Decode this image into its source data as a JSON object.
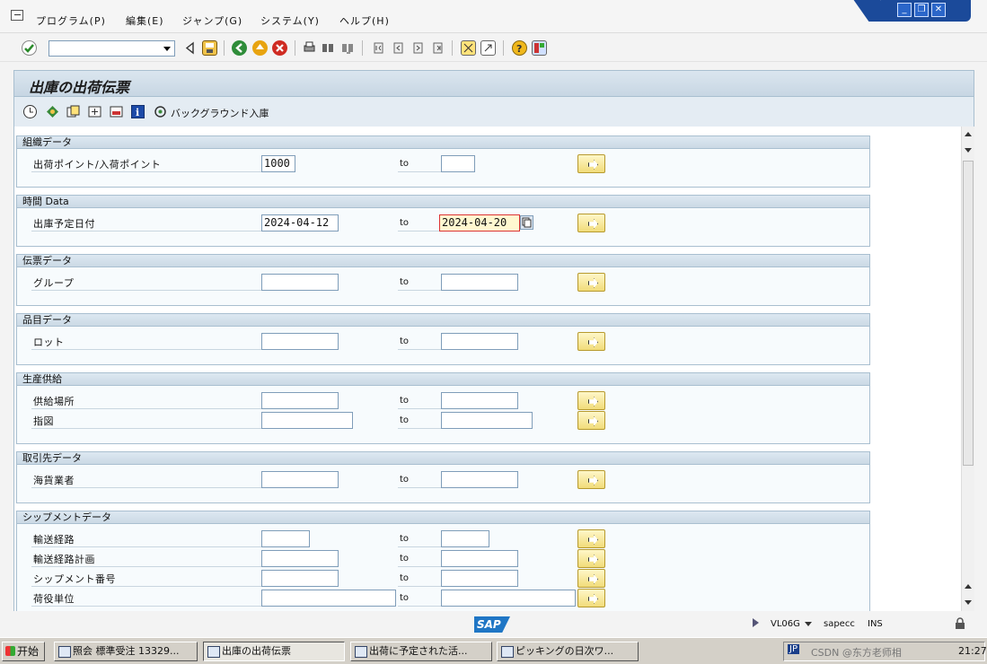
{
  "menubar": {
    "items": [
      "プログラム(P)",
      "編集(E)",
      "ジャンプ(G)",
      "システム(Y)",
      "ヘルプ(H)"
    ]
  },
  "window_controls": {
    "minimize": "_",
    "restore": "❐",
    "close": "✕"
  },
  "toolbar": {
    "command_value": "",
    "icons": [
      "enter-icon",
      "back-icon",
      "save-icon",
      "back-nav-icon",
      "exit-icon",
      "cancel-icon",
      "print-icon",
      "find-icon",
      "find-next-icon",
      "first-page-icon",
      "prev-page-icon",
      "next-page-icon",
      "last-page-icon",
      "new-session-icon",
      "shortcut-icon",
      "help-icon",
      "layout-icon"
    ]
  },
  "screen": {
    "title": "出庫の出荷伝票",
    "app_toolbar": {
      "background_receipt_label": "バックグラウンド入庫"
    }
  },
  "form": {
    "to_label": "to",
    "groups": [
      {
        "title": "組織データ",
        "rows": [
          {
            "label": "出荷ポイント/入荷ポイント",
            "from": "1000",
            "to": ""
          }
        ]
      },
      {
        "title": "時間 Data",
        "rows": [
          {
            "label": "出庫予定日付",
            "from": "2024-04-12",
            "to": "2024-04-20"
          }
        ]
      },
      {
        "title": "伝票データ",
        "rows": [
          {
            "label": "グループ",
            "from": "",
            "to": ""
          }
        ]
      },
      {
        "title": "品目データ",
        "rows": [
          {
            "label": "ロット",
            "from": "",
            "to": ""
          }
        ]
      },
      {
        "title": "生産供給",
        "rows": [
          {
            "label": "供給場所",
            "from": "",
            "to": ""
          },
          {
            "label": "指図",
            "from": "",
            "to": ""
          }
        ]
      },
      {
        "title": "取引先データ",
        "rows": [
          {
            "label": "海貨業者",
            "from": "",
            "to": ""
          }
        ]
      },
      {
        "title": "シップメントデータ",
        "rows": [
          {
            "label": "輸送経路",
            "from": "",
            "to": ""
          },
          {
            "label": "輸送経路計画",
            "from": "",
            "to": ""
          },
          {
            "label": "シップメント番号",
            "from": "",
            "to": ""
          },
          {
            "label": "荷役単位",
            "from": "",
            "to": ""
          }
        ]
      }
    ]
  },
  "statusbar": {
    "logo": "SAP",
    "transaction": "VL06G",
    "server": "sapecc",
    "mode": "INS"
  },
  "taskbar": {
    "start": "开始",
    "tasks": [
      "照会 標準受注 13329...",
      "出庫の出荷伝票",
      "出荷に予定された活...",
      "ピッキングの日次ワ..."
    ],
    "lang": "JP",
    "clock": "21:27",
    "watermark": "CSDN @东方老师相"
  },
  "colors": {
    "accent": "#1b4a9a",
    "highlight_field": "#fff8d0",
    "button": "#f1dc7a"
  }
}
